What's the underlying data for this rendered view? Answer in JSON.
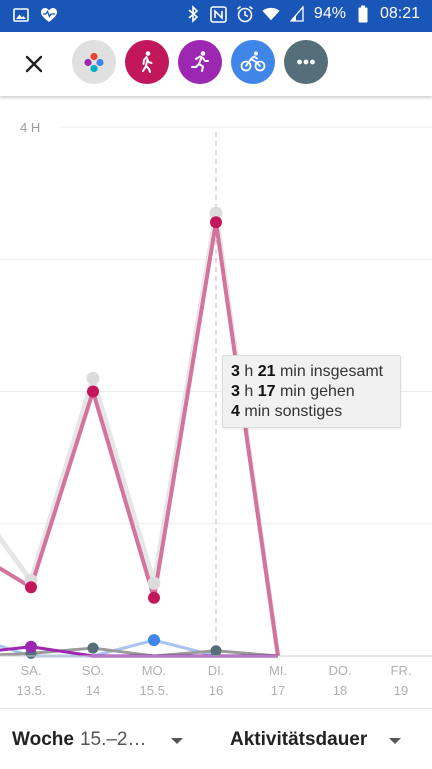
{
  "status_bar": {
    "battery": "94%",
    "time": "08:21",
    "icons": [
      "image-icon",
      "heart-icon",
      "bluetooth-icon",
      "nfc-icon",
      "alarm-icon",
      "wifi-icon",
      "signal-icon",
      "battery-icon"
    ]
  },
  "toolbar": {
    "close_icon": "close-icon",
    "activities": [
      {
        "name": "all-activities",
        "icon": "dots-icon",
        "color": "#e0e0e0"
      },
      {
        "name": "walking",
        "icon": "walk-icon",
        "color": "#c2185b"
      },
      {
        "name": "running",
        "icon": "run-icon",
        "color": "#9c27b0"
      },
      {
        "name": "cycling",
        "icon": "bike-icon",
        "color": "#3f86e8"
      },
      {
        "name": "more",
        "icon": "more-icon",
        "color": "#546e7a"
      }
    ]
  },
  "chart_data": {
    "type": "line",
    "ylabel_tick": "4 H",
    "categories": [
      {
        "day": "SA.",
        "date": "13.5."
      },
      {
        "day": "SO.",
        "date": "14"
      },
      {
        "day": "MO.",
        "date": "15.5."
      },
      {
        "day": "DI.",
        "date": "16"
      },
      {
        "day": "MI.",
        "date": "17"
      },
      {
        "day": "DO.",
        "date": "18"
      },
      {
        "day": "FR.",
        "date": "19"
      }
    ],
    "ylim": [
      0,
      4
    ],
    "series": [
      {
        "color": "#e6e6e6",
        "values": [
          0.57,
          2.1,
          0.55,
          3.35,
          0,
          null,
          null
        ],
        "prev": 1.2
      },
      {
        "color": "#d4739c",
        "values": [
          0.52,
          2.0,
          0.44,
          3.28,
          0,
          null,
          null
        ],
        "prev": 0.8
      },
      {
        "color": "#a9c4f0",
        "values": [
          0,
          0,
          0.12,
          0,
          0,
          null,
          null
        ],
        "prev": 0.15
      },
      {
        "color": "#9a9a9a",
        "values": [
          0.02,
          0.06,
          0,
          0.04,
          0,
          null,
          null
        ],
        "prev": 0
      },
      {
        "color": "#9c27b0",
        "values": [
          0.07,
          0,
          0,
          0,
          0,
          null,
          null
        ],
        "prev": 0.02
      }
    ],
    "tooltip": {
      "lines": [
        {
          "h": "3",
          "hunit": "h",
          "m": "21",
          "munit": "min",
          "label": "insgesamt"
        },
        {
          "h": "3",
          "hunit": "h",
          "m": "17",
          "munit": "min",
          "label": "gehen"
        },
        {
          "m": "4",
          "munit": "min",
          "label": "sonstiges"
        }
      ]
    }
  },
  "bottom_bar": {
    "period_label": "Woche",
    "period_value": "15.–2…",
    "metric_label": "Aktivitätsdauer"
  }
}
